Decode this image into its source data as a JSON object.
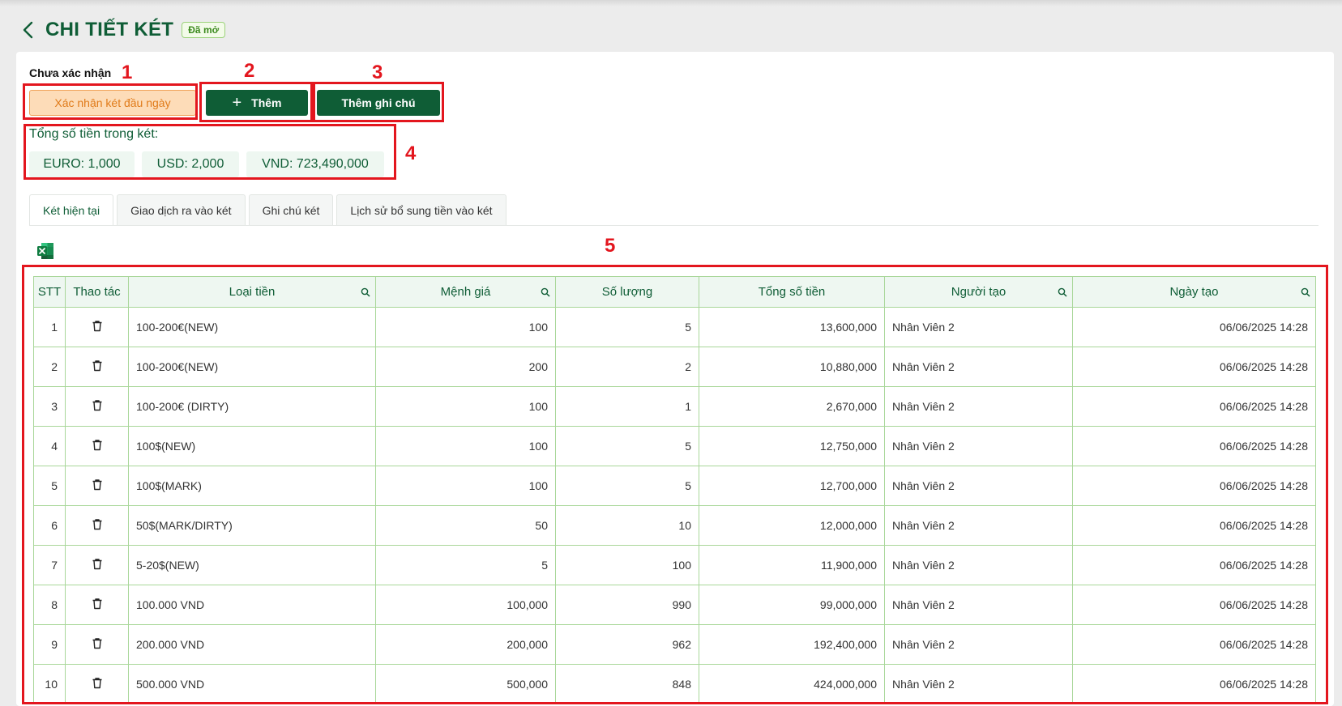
{
  "header": {
    "title": "CHI TIẾT KÉT",
    "badge": "Đã mở"
  },
  "status": {
    "label": "Chưa xác nhận"
  },
  "toolbar": {
    "confirm_label": "Xác nhận két đầu ngày",
    "add_label": "Thêm",
    "add_note_label": "Thêm ghi chú"
  },
  "totals": {
    "label": "Tổng số tiền trong két:",
    "items": [
      "EURO: 1,000",
      "USD: 2,000",
      "VND: 723,490,000"
    ]
  },
  "tabs": [
    "Két hiện tại",
    "Giao dịch ra vào két",
    "Ghi chú két",
    "Lịch sử bổ sung tiền vào két"
  ],
  "annotations": [
    "1",
    "2",
    "3",
    "4",
    "5"
  ],
  "table": {
    "columns": [
      "STT",
      "Thao tác",
      "Loại tiền",
      "Mệnh giá",
      "Số lượng",
      "Tổng số tiền",
      "Người tạo",
      "Ngày tạo"
    ],
    "rows": [
      {
        "stt": "1",
        "type": "100-200€(NEW)",
        "denom": "100",
        "qty": "5",
        "total": "13,600,000",
        "creator": "Nhân Viên 2",
        "date": "06/06/2025 14:28"
      },
      {
        "stt": "2",
        "type": "100-200€(NEW)",
        "denom": "200",
        "qty": "2",
        "total": "10,880,000",
        "creator": "Nhân Viên 2",
        "date": "06/06/2025 14:28"
      },
      {
        "stt": "3",
        "type": "100-200€ (DIRTY)",
        "denom": "100",
        "qty": "1",
        "total": "2,670,000",
        "creator": "Nhân Viên 2",
        "date": "06/06/2025 14:28"
      },
      {
        "stt": "4",
        "type": "100$(NEW)",
        "denom": "100",
        "qty": "5",
        "total": "12,750,000",
        "creator": "Nhân Viên 2",
        "date": "06/06/2025 14:28"
      },
      {
        "stt": "5",
        "type": "100$(MARK)",
        "denom": "100",
        "qty": "5",
        "total": "12,700,000",
        "creator": "Nhân Viên 2",
        "date": "06/06/2025 14:28"
      },
      {
        "stt": "6",
        "type": "50$(MARK/DIRTY)",
        "denom": "50",
        "qty": "10",
        "total": "12,000,000",
        "creator": "Nhân Viên 2",
        "date": "06/06/2025 14:28"
      },
      {
        "stt": "7",
        "type": "5-20$(NEW)",
        "denom": "5",
        "qty": "100",
        "total": "11,900,000",
        "creator": "Nhân Viên 2",
        "date": "06/06/2025 14:28"
      },
      {
        "stt": "8",
        "type": "100.000 VND",
        "denom": "100,000",
        "qty": "990",
        "total": "99,000,000",
        "creator": "Nhân Viên 2",
        "date": "06/06/2025 14:28"
      },
      {
        "stt": "9",
        "type": "200.000 VND",
        "denom": "200,000",
        "qty": "962",
        "total": "192,400,000",
        "creator": "Nhân Viên 2",
        "date": "06/06/2025 14:28"
      },
      {
        "stt": "10",
        "type": "500.000 VND",
        "denom": "500,000",
        "qty": "848",
        "total": "424,000,000",
        "creator": "Nhân Viên 2",
        "date": "06/06/2025 14:28"
      }
    ]
  },
  "icons": {
    "back": "chevron-left-icon",
    "excel": "excel-export-icon",
    "delete": "trash-icon",
    "filter": "search-icon"
  },
  "colors": {
    "brand_green": "#0f5d36",
    "confirm_orange": "#fddcb8",
    "annotation_red": "#e3161e",
    "table_border": "#a9d79a"
  }
}
